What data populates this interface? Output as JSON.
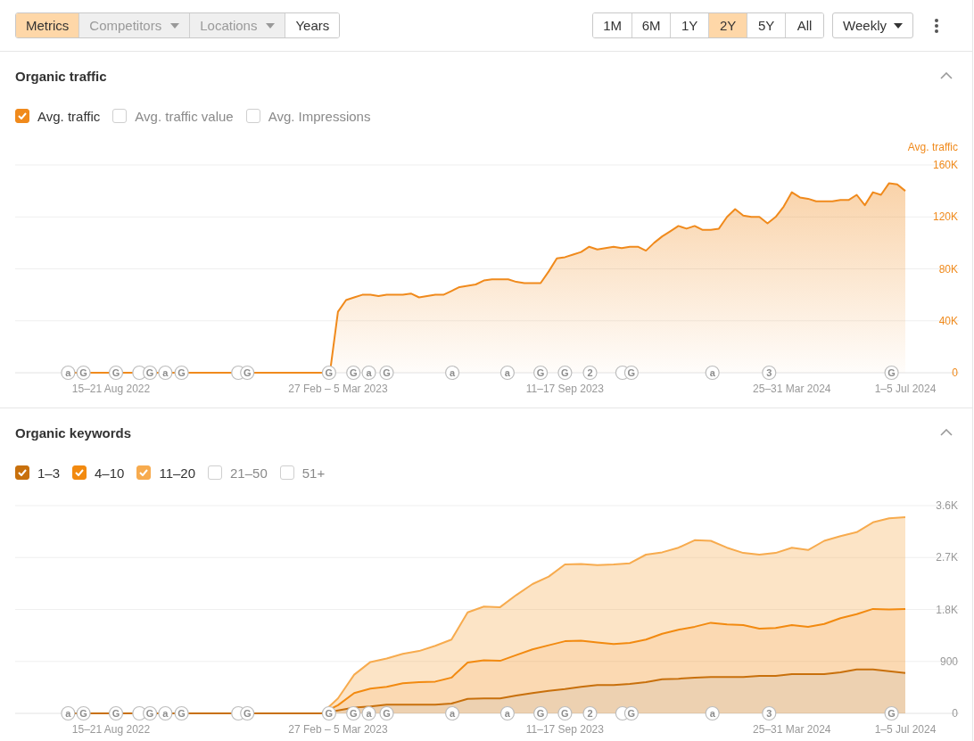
{
  "toolbar": {
    "view_tabs": [
      {
        "label": "Metrics",
        "selected": true,
        "disabled": false,
        "dropdown": false
      },
      {
        "label": "Competitors",
        "selected": false,
        "disabled": true,
        "dropdown": true
      },
      {
        "label": "Locations",
        "selected": false,
        "disabled": true,
        "dropdown": true
      },
      {
        "label": "Years",
        "selected": false,
        "disabled": false,
        "dropdown": false
      }
    ],
    "ranges": [
      {
        "label": "1M",
        "selected": false
      },
      {
        "label": "6M",
        "selected": false
      },
      {
        "label": "1Y",
        "selected": false
      },
      {
        "label": "2Y",
        "selected": true
      },
      {
        "label": "5Y",
        "selected": false
      },
      {
        "label": "All",
        "selected": false
      }
    ],
    "interval": {
      "value": "Weekly"
    }
  },
  "sections": [
    {
      "title": "Organic traffic",
      "expanded": true,
      "metrics": [
        {
          "label": "Avg. traffic",
          "checked": true,
          "color": "#f08a1c"
        },
        {
          "label": "Avg. traffic value",
          "checked": false
        },
        {
          "label": "Avg. Impressions",
          "checked": false
        }
      ],
      "chart": {
        "chart_data": {
          "type": "area",
          "ylabel": "Avg. traffic",
          "grid": true,
          "categories": [
            null,
            null,
            null,
            null,
            null,
            null,
            "15–21 Aug 2022",
            null,
            null,
            null,
            null,
            null,
            null,
            null,
            null,
            null,
            null,
            null,
            null,
            null,
            null,
            null,
            null,
            null,
            null,
            null,
            null,
            null,
            null,
            null,
            null,
            null,
            null,
            null,
            "27 Feb – 5 Mar 2023",
            null,
            null,
            null,
            null,
            null,
            null,
            null,
            null,
            null,
            null,
            null,
            null,
            null,
            null,
            null,
            null,
            null,
            null,
            null,
            null,
            null,
            null,
            null,
            null,
            null,
            null,
            null,
            "11–17 Sep 2023",
            null,
            null,
            null,
            null,
            null,
            null,
            null,
            null,
            null,
            null,
            null,
            null,
            null,
            null,
            null,
            null,
            null,
            null,
            null,
            null,
            null,
            null,
            null,
            null,
            null,
            null,
            null,
            "25–31 Mar 2024",
            null,
            null,
            null,
            null,
            null,
            null,
            null,
            null,
            null,
            null,
            null,
            null,
            null,
            "1–5 Jul 2024"
          ],
          "series": [
            {
              "color": "#f08a1c",
              "values": [
                0,
                0,
                0,
                0,
                0,
                0,
                0,
                0,
                0,
                0,
                0,
                0,
                0,
                null,
                0,
                null,
                0,
                0,
                0,
                0,
                0,
                0,
                null,
                null,
                0,
                0,
                0,
                0,
                0,
                0,
                0,
                0,
                0,
                0,
                47000,
                56000,
                58000,
                60000,
                60000,
                59000,
                60000,
                60000,
                60000,
                61000,
                58000,
                59000,
                60000,
                60000,
                63000,
                66000,
                67000,
                68000,
                71000,
                72000,
                72000,
                72000,
                70000,
                69000,
                69000,
                69000,
                78000,
                88000,
                89000,
                91000,
                93000,
                97000,
                95000,
                96000,
                97000,
                96000,
                97000,
                97000,
                94000,
                100000,
                105000,
                109000,
                113000,
                111000,
                113000,
                110000,
                110000,
                111000,
                120000,
                126000,
                121000,
                120000,
                120000,
                115000,
                120000,
                128000,
                139000,
                135000,
                134000,
                132000,
                132000,
                132000,
                133000,
                133000,
                137000,
                129000,
                139000,
                137000,
                146000,
                145000,
                140000
              ]
            }
          ],
          "ylim": [
            0,
            160000
          ],
          "yticks": [
            {
              "value": 0,
              "label": "0"
            },
            {
              "value": 40000,
              "label": "40K"
            },
            {
              "value": 80000,
              "label": "80K"
            },
            {
              "value": 120000,
              "label": "120K"
            },
            {
              "value": 160000,
              "label": "160K"
            }
          ]
        },
        "events": [
          {
            "text": "a"
          },
          {
            "text": "G"
          },
          {
            "text": "G"
          },
          {
            "covered": true
          },
          {
            "text": "G"
          },
          {
            "text": "a"
          },
          {
            "text": "G"
          },
          {
            "covered": true
          },
          {
            "text": "G"
          },
          {
            "text": "G"
          },
          {
            "text": "G"
          },
          {
            "text": "a"
          },
          {
            "text": "G"
          },
          {
            "text": "a"
          },
          {
            "text": "a"
          },
          {
            "text": "G"
          },
          {
            "text": "G"
          },
          {
            "text": "2"
          },
          {
            "covered": true
          },
          {
            "text": "G"
          },
          {
            "text": "a"
          },
          {
            "text": "3"
          },
          {
            "text": "G"
          }
        ]
      }
    },
    {
      "title": "Organic keywords",
      "expanded": true,
      "metrics": [
        {
          "label": "1–3",
          "checked": true,
          "color": "#c8700c"
        },
        {
          "label": "4–10",
          "checked": true,
          "color": "#f28a10"
        },
        {
          "label": "11–20",
          "checked": true,
          "color": "#f7ab4e"
        },
        {
          "label": "21–50",
          "checked": false
        },
        {
          "label": "51+",
          "checked": false
        }
      ],
      "chart": {
        "chart_data": {
          "type": "area",
          "stacked": true,
          "grid": true,
          "categories": [
            null,
            null,
            null,
            "15–21 Aug 2022",
            null,
            null,
            null,
            null,
            null,
            null,
            null,
            null,
            null,
            null,
            null,
            null,
            null,
            "27 Feb – 5 Mar 2023",
            null,
            null,
            null,
            null,
            null,
            null,
            null,
            null,
            null,
            null,
            null,
            null,
            null,
            "11–17 Sep 2023",
            null,
            null,
            null,
            null,
            null,
            null,
            null,
            null,
            null,
            null,
            null,
            null,
            null,
            "25–31 Mar 2024",
            null,
            null,
            null,
            null,
            null,
            null,
            "1–5 Jul 2024"
          ],
          "series": [
            {
              "color": "#c8700c",
              "values": [
                0,
                0,
                0,
                0,
                0,
                0,
                0,
                0,
                0,
                0,
                0,
                null,
                0,
                0,
                0,
                0,
                0,
                50,
                100,
                120,
                150,
                150,
                150,
                150,
                170,
                250,
                260,
                260,
                310,
                350,
                390,
                420,
                460,
                490,
                490,
                510,
                540,
                590,
                600,
                620,
                630,
                630,
                630,
                650,
                650,
                680,
                680,
                680,
                710,
                760,
                760,
                730,
                700
              ]
            },
            {
              "color": "#f28a10",
              "values": [
                0,
                0,
                0,
                0,
                0,
                0,
                0,
                0,
                0,
                0,
                0,
                null,
                0,
                0,
                0,
                0,
                0,
                90,
                250,
                310,
                310,
                370,
                390,
                400,
                450,
                630,
                660,
                650,
                700,
                760,
                790,
                830,
                800,
                740,
                710,
                710,
                740,
                790,
                850,
                880,
                940,
                910,
                900,
                820,
                830,
                850,
                820,
                870,
                940,
                960,
                1050,
                1070,
                1110
              ]
            },
            {
              "color": "#f7ab4e",
              "values": [
                0,
                0,
                0,
                0,
                0,
                0,
                0,
                0,
                0,
                0,
                0,
                null,
                0,
                0,
                0,
                0,
                0,
                120,
                320,
                460,
                490,
                510,
                540,
                620,
                660,
                870,
                930,
                930,
                1040,
                1130,
                1190,
                1330,
                1330,
                1340,
                1380,
                1380,
                1470,
                1410,
                1420,
                1500,
                1420,
                1330,
                1250,
                1280,
                1300,
                1340,
                1330,
                1440,
                1420,
                1420,
                1500,
                1580,
                1590
              ]
            }
          ],
          "ylim": [
            0,
            3600
          ],
          "yticks": [
            {
              "value": 0,
              "label": "0"
            },
            {
              "value": 900,
              "label": "900"
            },
            {
              "value": 1800,
              "label": "1.8K"
            },
            {
              "value": 2700,
              "label": "2.7K"
            },
            {
              "value": 3600,
              "label": "3.6K"
            }
          ]
        },
        "events": [
          {
            "text": "a"
          },
          {
            "text": "G"
          },
          {
            "text": "G"
          },
          {
            "covered": true
          },
          {
            "text": "G"
          },
          {
            "text": "a"
          },
          {
            "text": "G"
          },
          {
            "covered": true
          },
          {
            "text": "G"
          },
          {
            "text": "G"
          },
          {
            "text": "G"
          },
          {
            "text": "a"
          },
          {
            "text": "G"
          },
          {
            "text": "a"
          },
          {
            "text": "a"
          },
          {
            "text": "G"
          },
          {
            "text": "G"
          },
          {
            "text": "2"
          },
          {
            "covered": true
          },
          {
            "text": "G"
          },
          {
            "text": "a"
          },
          {
            "text": "3"
          },
          {
            "text": "G"
          }
        ]
      }
    }
  ]
}
